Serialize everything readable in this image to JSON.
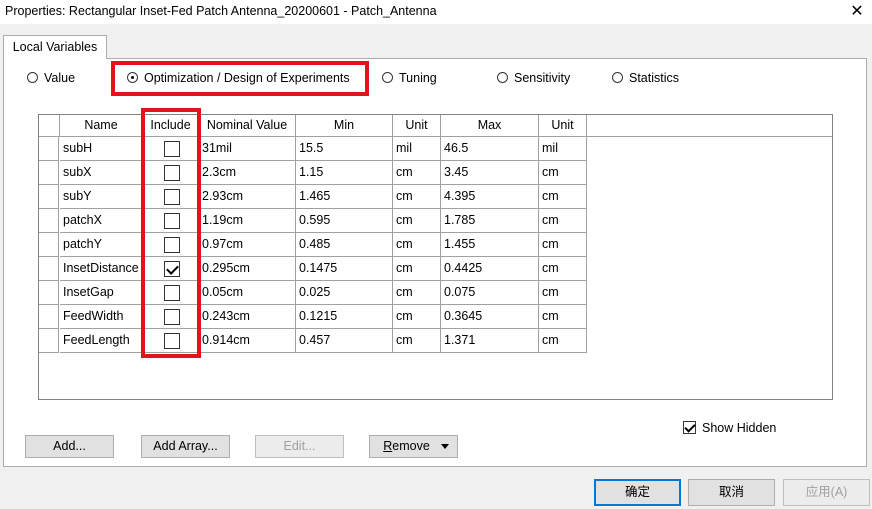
{
  "window": {
    "title": "Properties: Rectangular Inset-Fed Patch Antenna_20200601 - Patch_Antenna",
    "close_glyph": "✕"
  },
  "tab": {
    "label": "Local Variables"
  },
  "modes": {
    "value": "Value",
    "optimization": "Optimization / Design of Experiments",
    "tuning": "Tuning",
    "sensitivity": "Sensitivity",
    "statistics": "Statistics",
    "selected": "optimization"
  },
  "table": {
    "columns": {
      "name": "Name",
      "include": "Include",
      "nominal": "Nominal Value",
      "min": "Min",
      "unit1": "Unit",
      "max": "Max",
      "unit2": "Unit"
    },
    "rows": [
      {
        "name": "subH",
        "include": false,
        "nominal": "31mil",
        "min": "15.5",
        "unit1": "mil",
        "max": "46.5",
        "unit2": "mil"
      },
      {
        "name": "subX",
        "include": false,
        "nominal": "2.3cm",
        "min": "1.15",
        "unit1": "cm",
        "max": "3.45",
        "unit2": "cm"
      },
      {
        "name": "subY",
        "include": false,
        "nominal": "2.93cm",
        "min": "1.465",
        "unit1": "cm",
        "max": "4.395",
        "unit2": "cm"
      },
      {
        "name": "patchX",
        "include": false,
        "nominal": "1.19cm",
        "min": "0.595",
        "unit1": "cm",
        "max": "1.785",
        "unit2": "cm"
      },
      {
        "name": "patchY",
        "include": false,
        "nominal": "0.97cm",
        "min": "0.485",
        "unit1": "cm",
        "max": "1.455",
        "unit2": "cm"
      },
      {
        "name": "InsetDistance",
        "include": true,
        "nominal": "0.295cm",
        "min": "0.1475",
        "unit1": "cm",
        "max": "0.4425",
        "unit2": "cm"
      },
      {
        "name": "InsetGap",
        "include": false,
        "nominal": "0.05cm",
        "min": "0.025",
        "unit1": "cm",
        "max": "0.075",
        "unit2": "cm"
      },
      {
        "name": "FeedWidth",
        "include": false,
        "nominal": "0.243cm",
        "min": "0.1215",
        "unit1": "cm",
        "max": "0.3645",
        "unit2": "cm"
      },
      {
        "name": "FeedLength",
        "include": false,
        "nominal": "0.914cm",
        "min": "0.457",
        "unit1": "cm",
        "max": "1.371",
        "unit2": "cm"
      }
    ]
  },
  "show_hidden": {
    "label": "Show Hidden",
    "checked": true
  },
  "buttons": {
    "add": "Add...",
    "add_array": "Add Array...",
    "edit": "Edit...",
    "remove_underlined": "R",
    "remove_rest": "emove",
    "ok": "确定",
    "cancel": "取消",
    "apply": "应用(A)"
  },
  "highlight_color": "#e0141a"
}
